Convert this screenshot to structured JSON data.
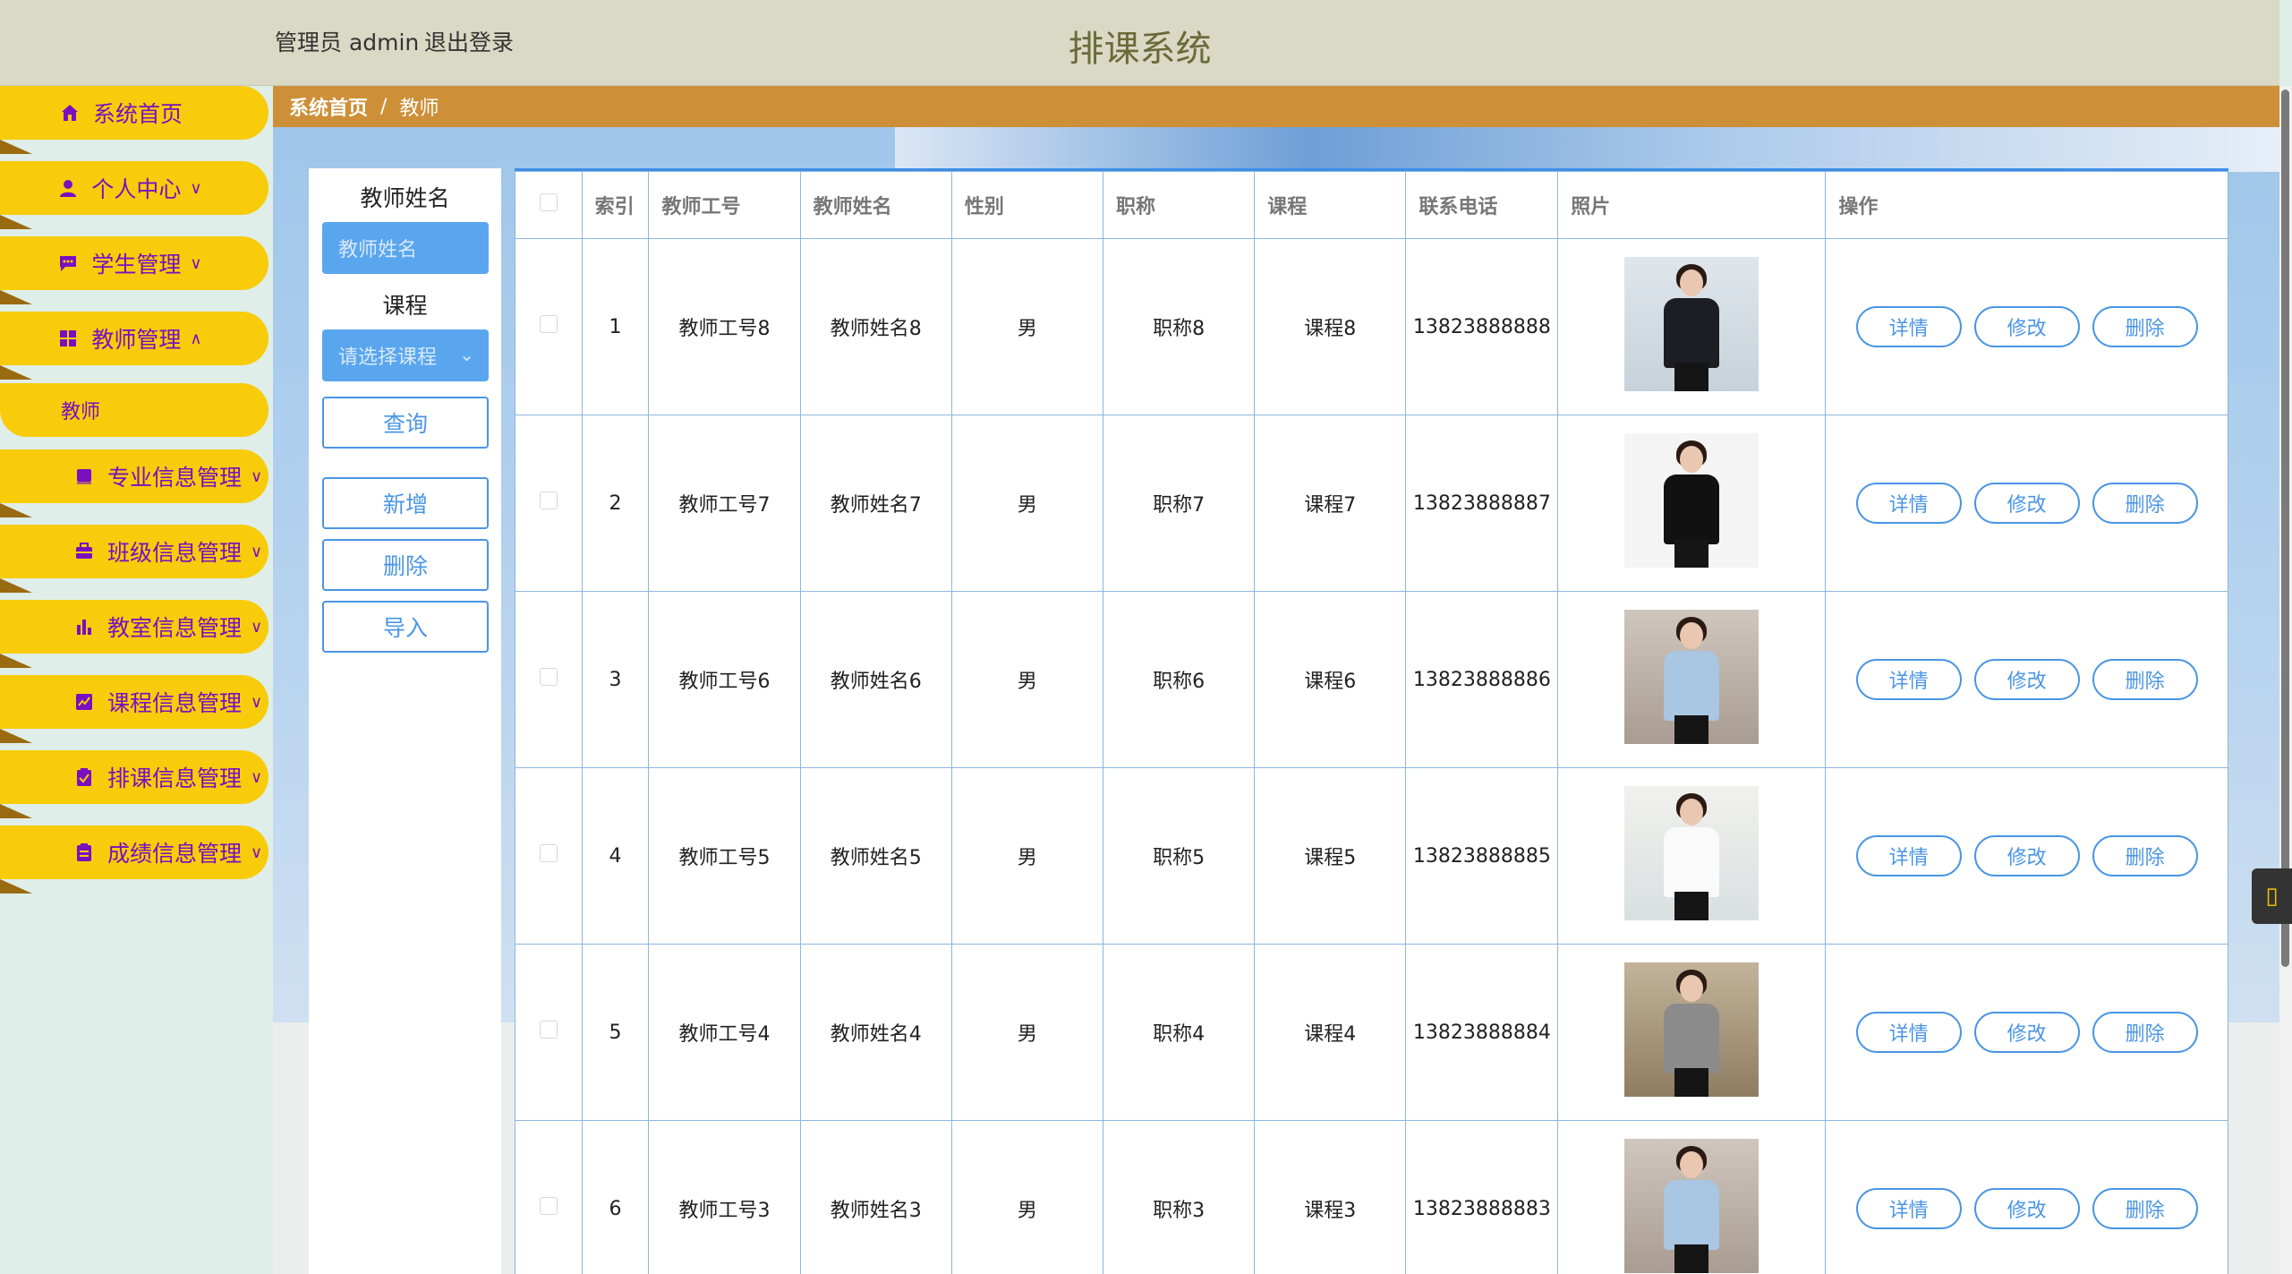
{
  "header": {
    "user_label": "管理员 admin",
    "logout_label": "退出登录",
    "title": "排课系统"
  },
  "sidebar": {
    "items": [
      {
        "label": "系统首页",
        "icon": "home-icon",
        "arrow": ""
      },
      {
        "label": "个人中心",
        "icon": "user-icon",
        "arrow": "∨"
      },
      {
        "label": "学生管理",
        "icon": "chat-icon",
        "arrow": "∨"
      },
      {
        "label": "教师管理",
        "icon": "grid-icon",
        "arrow": "∧"
      },
      {
        "label": "专业信息管理",
        "icon": "book-icon",
        "arrow": "∨"
      },
      {
        "label": "班级信息管理",
        "icon": "briefcase-icon",
        "arrow": "∨"
      },
      {
        "label": "教室信息管理",
        "icon": "bar-chart-icon",
        "arrow": "∨"
      },
      {
        "label": "课程信息管理",
        "icon": "trend-icon",
        "arrow": "∨"
      },
      {
        "label": "排课信息管理",
        "icon": "clipboard-check-icon",
        "arrow": "∨"
      },
      {
        "label": "成绩信息管理",
        "icon": "clipboard-icon",
        "arrow": "∨"
      }
    ],
    "sub_item": "教师"
  },
  "breadcrumb": {
    "home": "系统首页",
    "sep": "/",
    "current": "教师"
  },
  "search": {
    "name_label": "教师姓名",
    "name_placeholder": "教师姓名",
    "course_label": "课程",
    "course_placeholder": "请选择课程",
    "query_btn": "查询",
    "add_btn": "新增",
    "delete_btn": "删除",
    "import_btn": "导入"
  },
  "table": {
    "headers": [
      "索引",
      "教师工号",
      "教师姓名",
      "性别",
      "职称",
      "课程",
      "联系电话",
      "照片",
      "操作"
    ],
    "rows": [
      {
        "index": "1",
        "no": "教师工号8",
        "name": "教师姓名8",
        "gender": "男",
        "title": "职称8",
        "course": "课程8",
        "phone": "13823888888"
      },
      {
        "index": "2",
        "no": "教师工号7",
        "name": "教师姓名7",
        "gender": "男",
        "title": "职称7",
        "course": "课程7",
        "phone": "13823888887"
      },
      {
        "index": "3",
        "no": "教师工号6",
        "name": "教师姓名6",
        "gender": "男",
        "title": "职称6",
        "course": "课程6",
        "phone": "13823888886"
      },
      {
        "index": "4",
        "no": "教师工号5",
        "name": "教师姓名5",
        "gender": "男",
        "title": "职称5",
        "course": "课程5",
        "phone": "13823888885"
      },
      {
        "index": "5",
        "no": "教师工号4",
        "name": "教师姓名4",
        "gender": "男",
        "title": "职称4",
        "course": "课程4",
        "phone": "13823888884"
      },
      {
        "index": "6",
        "no": "教师工号3",
        "name": "教师姓名3",
        "gender": "男",
        "title": "职称3",
        "course": "课程3",
        "phone": "13823888883"
      }
    ],
    "actions": {
      "detail": "详情",
      "edit": "修改",
      "delete": "删除"
    }
  },
  "colors": {
    "header_bg": "#d9d9c5",
    "nav_bg": "#f8cc0a",
    "nav_text": "#7a0fc0",
    "breadcrumb_bg": "#cd8f38",
    "accent": "#4a95e5"
  }
}
